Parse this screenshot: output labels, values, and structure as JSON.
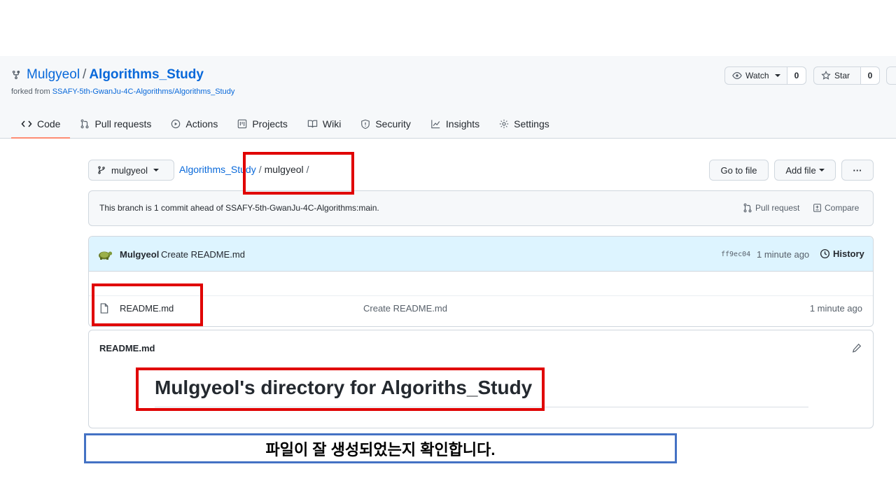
{
  "repo": {
    "owner": "Mulgyeol",
    "separator": "/",
    "name": "Algorithms_Study",
    "forked_from_prefix": "forked from",
    "forked_from_link": "SSAFY-5th-GwanJu-4C-Algorithms/Algorithms_Study",
    "fork_icon": "repo-forked-icon"
  },
  "header_buttons": {
    "watch": {
      "label": "Watch",
      "count": "0"
    },
    "star": {
      "label": "Star",
      "count": "0"
    }
  },
  "tabs": [
    {
      "label": "Code",
      "icon": "code-icon",
      "active": true
    },
    {
      "label": "Pull requests",
      "icon": "pull-request-icon"
    },
    {
      "label": "Actions",
      "icon": "play-icon"
    },
    {
      "label": "Projects",
      "icon": "project-icon"
    },
    {
      "label": "Wiki",
      "icon": "book-icon"
    },
    {
      "label": "Security",
      "icon": "shield-icon"
    },
    {
      "label": "Insights",
      "icon": "graph-icon"
    },
    {
      "label": "Settings",
      "icon": "gear-icon"
    }
  ],
  "toolbar": {
    "branch": "mulgyeol",
    "breadcrumb_root": "Algorithms_Study",
    "breadcrumb_dir": "mulgyeol",
    "go_to_file": "Go to file",
    "add_file": "Add file",
    "more": "···"
  },
  "branch_status": {
    "message": "This branch is 1 commit ahead of SSAFY-5th-GwanJu-4C-Algorithms:main.",
    "pull_request": "Pull request",
    "compare": "Compare"
  },
  "latest_commit": {
    "author": "Mulgyeol",
    "message": "Create README.md",
    "sha": "ff9ec04",
    "time": "1 minute ago",
    "history": "History"
  },
  "files": [
    {
      "name": "README.md",
      "message": "Create README.md",
      "time": "1 minute ago"
    }
  ],
  "readme": {
    "filename": "README.md",
    "heading": "Mulgyeol's directory for Algoriths_Study"
  },
  "annotation": {
    "caption": "파일이 잘 생성되었는지 확인합니다.",
    "highlight_color": "#e00000",
    "caption_border_color": "#4472c4"
  },
  "colors": {
    "link": "#0969da",
    "active_tab_underline": "#fd8c73",
    "commit_row_bg": "#ddf4ff"
  }
}
